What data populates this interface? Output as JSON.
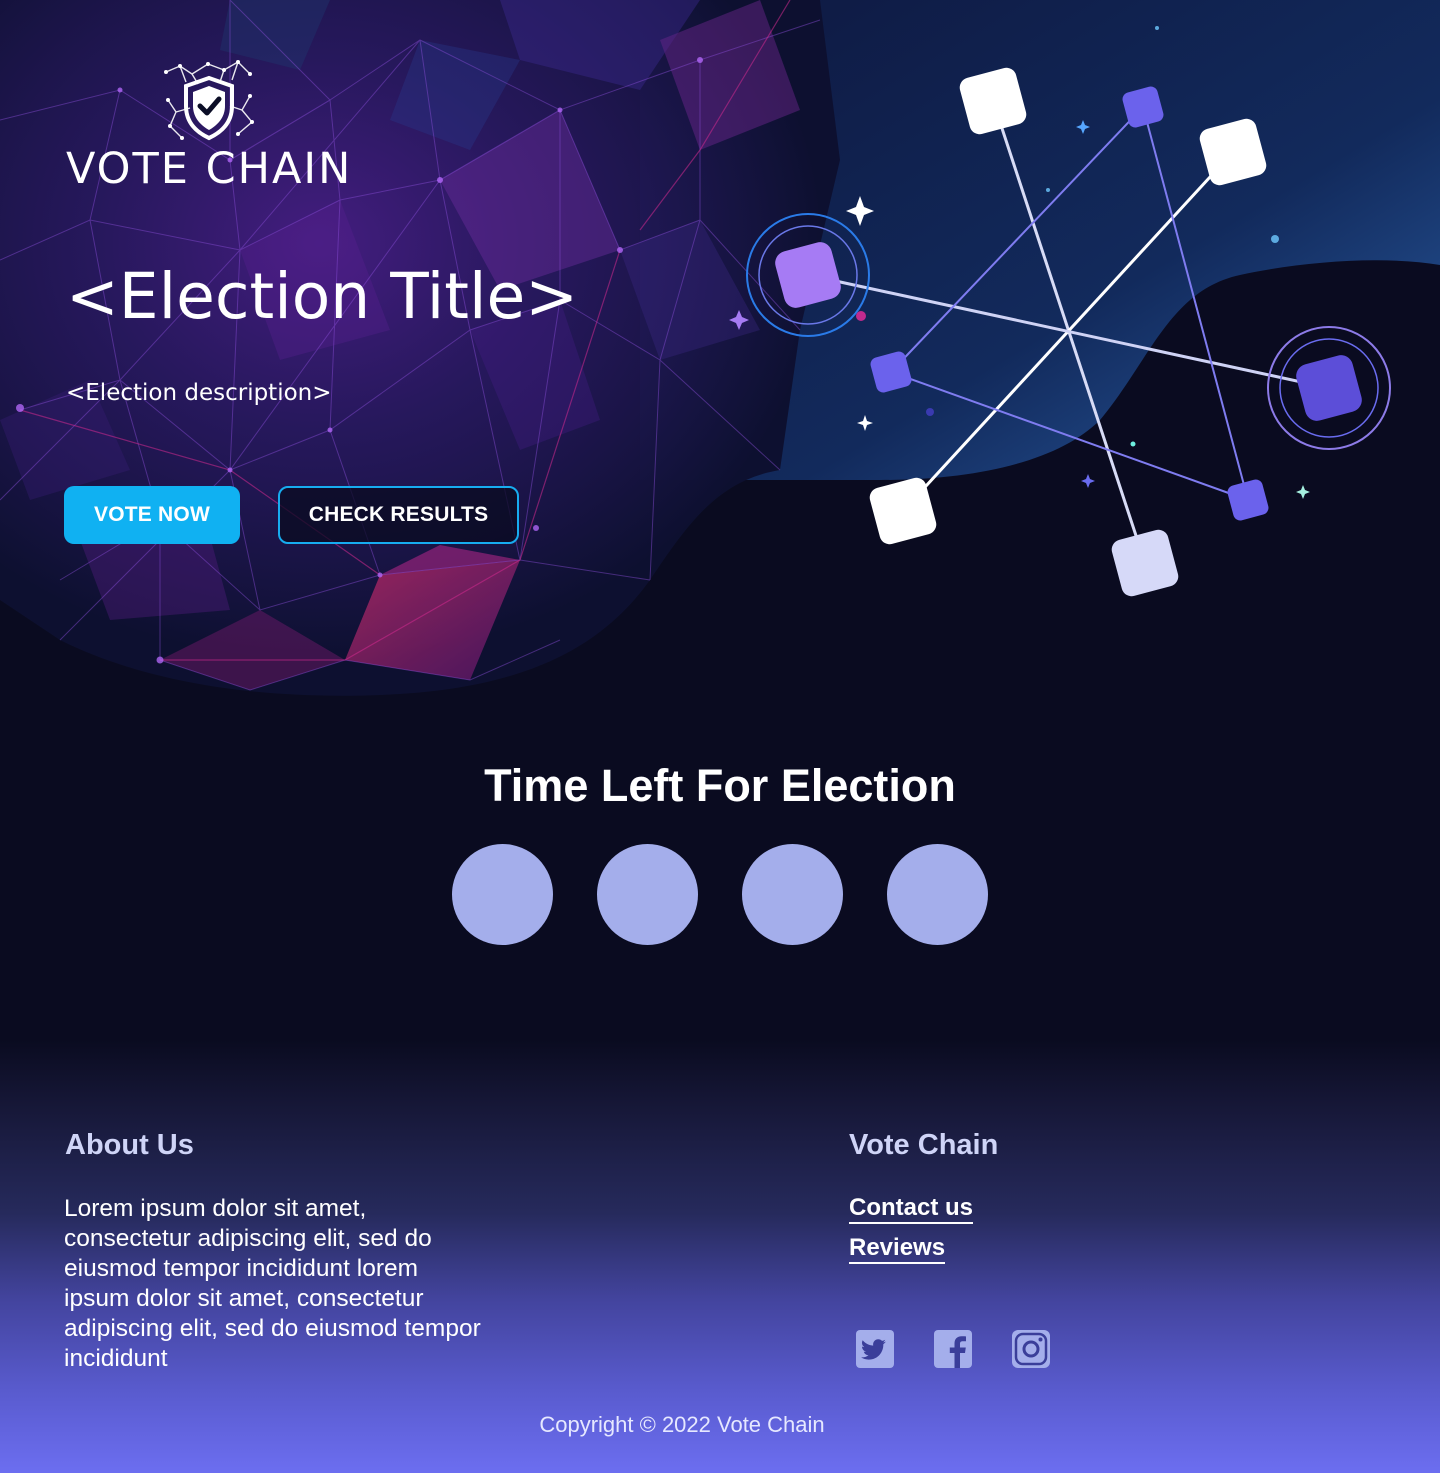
{
  "brand": {
    "name": "VOTE CHAIN"
  },
  "hero": {
    "title": "<Election Title>",
    "description": "<Election description>",
    "vote_button": "VOTE NOW",
    "results_button": "CHECK RESULTS"
  },
  "countdown": {
    "title": "Time Left For Election",
    "units": [
      "",
      "",
      "",
      ""
    ]
  },
  "footer": {
    "about": {
      "heading": "About Us",
      "text": "Lorem ipsum dolor sit amet, consectetur adipiscing elit, sed do eiusmod tempor incididunt lorem ipsum dolor sit amet, consectetur adipiscing elit, sed do eiusmod tempor incididunt"
    },
    "brand_column": {
      "heading": "Vote Chain",
      "links": [
        "Contact us",
        "Reviews"
      ]
    },
    "social": [
      "twitter-icon",
      "facebook-icon",
      "instagram-icon"
    ],
    "copyright": "Copyright © 2022 Vote Chain"
  },
  "colors": {
    "background": "#0a0b20",
    "primary_button": "#10b1f2",
    "countdown_circle": "#a4aeeb",
    "footer_gradient_end": "#6c6ef0",
    "accent_purple": "#7a6ff0"
  }
}
